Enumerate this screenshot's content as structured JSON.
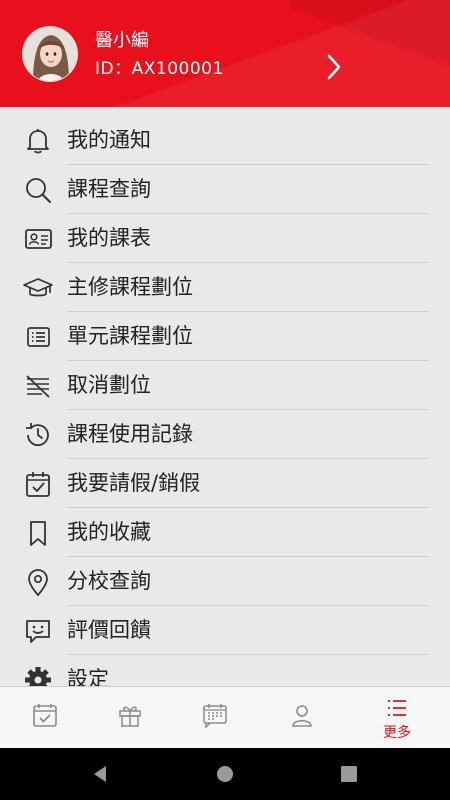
{
  "profile": {
    "name": "醫小編",
    "id_label": "ID：AX100001"
  },
  "menu": [
    {
      "label": "我的通知",
      "icon": "bell-icon"
    },
    {
      "label": "課程查詢",
      "icon": "search-icon"
    },
    {
      "label": "我的課表",
      "icon": "id-card-icon"
    },
    {
      "label": "主修課程劃位",
      "icon": "graduation-cap-icon"
    },
    {
      "label": "單元課程劃位",
      "icon": "list-icon"
    },
    {
      "label": "取消劃位",
      "icon": "cancel-list-icon"
    },
    {
      "label": "課程使用記錄",
      "icon": "history-icon"
    },
    {
      "label": "我要請假/銷假",
      "icon": "calendar-check-icon"
    },
    {
      "label": "我的收藏",
      "icon": "bookmark-icon"
    },
    {
      "label": "分校查詢",
      "icon": "location-pin-icon"
    },
    {
      "label": "評價回饋",
      "icon": "feedback-smile-icon"
    },
    {
      "label": "設定",
      "icon": "gear-icon"
    }
  ],
  "tabbar": {
    "tabs": [
      {
        "icon": "calendar-check-icon",
        "label": ""
      },
      {
        "icon": "gift-icon",
        "label": ""
      },
      {
        "icon": "calendar-chat-icon",
        "label": ""
      },
      {
        "icon": "person-icon",
        "label": ""
      },
      {
        "icon": "menu-list-icon",
        "label": "更多",
        "active": true
      }
    ]
  },
  "colors": {
    "brand": "#e8101c",
    "icon": "#333333",
    "tab_icon": "#8a8a8a"
  }
}
